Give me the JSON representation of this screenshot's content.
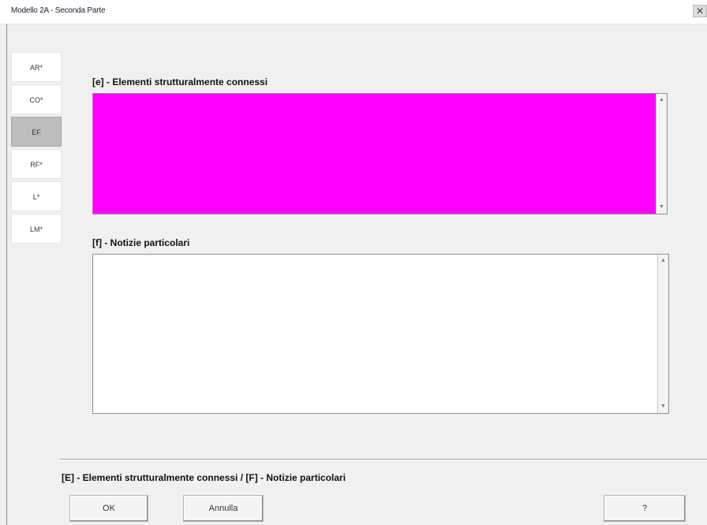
{
  "window": {
    "title": "Modello 2A - Seconda Parte",
    "close_glyph": "✕"
  },
  "tabs": [
    {
      "label": "AR*",
      "active": false
    },
    {
      "label": "CO*",
      "active": false
    },
    {
      "label": "EF",
      "active": true
    },
    {
      "label": "RF*",
      "active": false
    },
    {
      "label": "L*",
      "active": false
    },
    {
      "label": "LM*",
      "active": false
    }
  ],
  "section_e": {
    "label": "[e] - Elementi strutturalmente connessi",
    "value": "",
    "background": "#ff00ff"
  },
  "section_f": {
    "label": "[f] - Notizie particolari",
    "value": "",
    "background": "#ffffff"
  },
  "status_text": "[E] - Elementi strutturalmente connessi / [F] - Notizie particolari",
  "buttons": {
    "ok": "OK",
    "cancel": "Annulla",
    "help": "?"
  },
  "icons": {
    "scroll_up": "▲",
    "scroll_down": "▼"
  }
}
